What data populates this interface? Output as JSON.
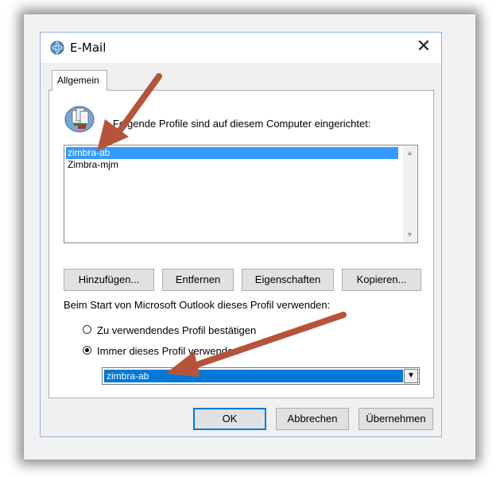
{
  "window": {
    "title": "E-Mail",
    "close_glyph": "✕"
  },
  "tabs": [
    {
      "label": "Allgemein"
    }
  ],
  "main": {
    "intro_text": "Folgende Profile sind auf diesem Computer eingerichtet:",
    "profiles": [
      "zimbra-ab",
      "Zimbra-mjm"
    ],
    "selected_profile_index": 0,
    "buttons": {
      "add": "Hinzufügen...",
      "remove": "Entfernen",
      "properties": "Eigenschaften",
      "copy": "Kopieren..."
    },
    "startup_label": "Beim Start von Microsoft Outlook dieses Profil verwenden:",
    "radio_confirm": "Zu verwendendes Profil bestätigen",
    "radio_always": "Immer dieses Profil verwenden",
    "selected_radio": "always",
    "combo_value": "zimbra-ab"
  },
  "footer": {
    "ok": "OK",
    "cancel": "Abbrechen",
    "apply": "Übernehmen"
  },
  "icons": {
    "title": "globe-mail-icon",
    "profile": "profile-cards-icon",
    "scroll_up": "chevron-up-icon",
    "scroll_down": "chevron-down-icon",
    "combo": "triangle-down-icon"
  },
  "colors": {
    "selection": "#3399ff",
    "combo_selection": "#0078d7",
    "annotation_arrow": "#b5543a"
  }
}
